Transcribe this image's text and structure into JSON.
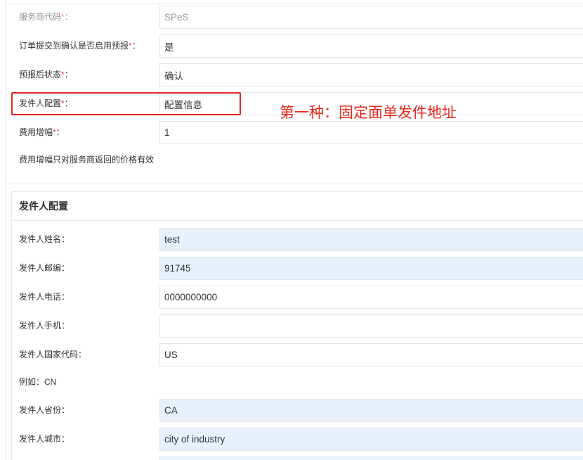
{
  "marks": {
    "required": "*",
    "colon": "："
  },
  "colors": {
    "annotation_red": "#e8281b",
    "required_red": "#f03c3c",
    "autofill_bg": "#e8f0fe",
    "border": "#e7eaec",
    "field_border": "#e5e6e7",
    "text": "#333333",
    "disabled_text": "#999999"
  },
  "annotation": {
    "note": "第一种：固定面单发件地址"
  },
  "service_panel": {
    "rows": [
      {
        "label": "服务商代码",
        "value": "SPeS"
      },
      {
        "label": "订单提交到确认是否启用预报",
        "value": "是"
      },
      {
        "label": "预报后状态",
        "value": "确认"
      },
      {
        "label": "发件人配置",
        "value": "配置信息"
      },
      {
        "label": "费用增幅",
        "value": "1"
      }
    ],
    "help": "费用增幅只对服务商返回的价格有效"
  },
  "sender_panel": {
    "title": "发件人配置",
    "rows": [
      {
        "label": "发件人姓名",
        "value": "test"
      },
      {
        "label": "发件人邮编",
        "value": "91745"
      },
      {
        "label": "发件人电话",
        "value": "0000000000"
      },
      {
        "label": "发件人手机",
        "value": ""
      },
      {
        "label": "发件人国家代码",
        "value": "US"
      },
      {
        "label": "发件人省份",
        "value": "CA"
      },
      {
        "label": "发件人城市",
        "value": "city of industry"
      }
    ],
    "country_code_hint": "例如：CN"
  }
}
